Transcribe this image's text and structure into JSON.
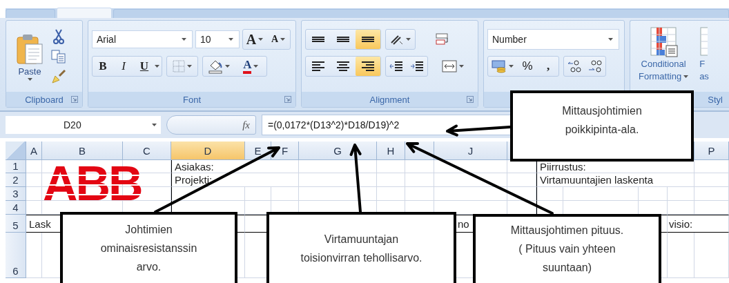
{
  "ribbon_tabs": [
    {
      "selected": false
    },
    {
      "selected": true
    },
    {
      "selected": false
    }
  ],
  "clipboard": {
    "paste": "Paste",
    "label": "Clipboard"
  },
  "font": {
    "name": "Arial",
    "size": "10",
    "grow": "A",
    "shrink": "A",
    "bold": "B",
    "italic": "I",
    "underline": "U",
    "font_color": "A",
    "label": "Font"
  },
  "alignment": {
    "vertical": [
      {
        "selected": false
      },
      {
        "selected": false
      },
      {
        "selected": true
      }
    ],
    "horizontal": [
      {
        "selected": false
      },
      {
        "selected": false
      },
      {
        "selected": true
      }
    ],
    "label": "Alignment"
  },
  "number": {
    "format": "Number",
    "percent": "%",
    "comma": ","
  },
  "styles": {
    "conditional": "Conditional",
    "formatting": "Formatting",
    "format_cut": "F",
    "as_cut": "as",
    "label": "Styl"
  },
  "formula_bar": {
    "name_box": "D20",
    "fx": "fx",
    "formula": "=(0,0172*(D13^2)*D18/D19)^2"
  },
  "sheet": {
    "columns": [
      {
        "label": "A",
        "selected": false
      },
      {
        "label": "B",
        "selected": false
      },
      {
        "label": "C",
        "selected": false
      },
      {
        "label": "D",
        "selected": true
      },
      {
        "label": "E",
        "selected": false
      },
      {
        "label": "F",
        "selected": false
      },
      {
        "label": "G",
        "selected": false
      },
      {
        "label": "H",
        "selected": false
      },
      {
        "selected": false
      },
      {
        "label": "J",
        "selected": false
      },
      {
        "label": "P",
        "selected": false
      }
    ],
    "logo": "ABB",
    "rows": [
      {
        "label": "1",
        "left": "Asiakas:",
        "right": "Piirrustus:"
      },
      {
        "label": "2",
        "left": "Projekti:",
        "right": "Virtamuuntajien laskenta"
      },
      {
        "label": "3"
      },
      {
        "label": "4"
      },
      {
        "label": "5",
        "first": "Lask",
        "middle": "no",
        "last": "visio:"
      },
      {
        "label": "6"
      }
    ]
  },
  "callouts": [
    {
      "lines": [
        "Mittausjohtimien",
        "poikkipinta-ala."
      ]
    },
    {
      "lines": [
        "Johtimien",
        "ominaisresistanssin",
        "arvo."
      ]
    },
    {
      "lines": [
        "Virtamuuntajan",
        "toisionvirran tehollisarvo."
      ]
    },
    {
      "lines": [
        "Mittausjohtimen pituus.",
        "( Pituus vain yhteen",
        "suuntaan)"
      ]
    }
  ]
}
